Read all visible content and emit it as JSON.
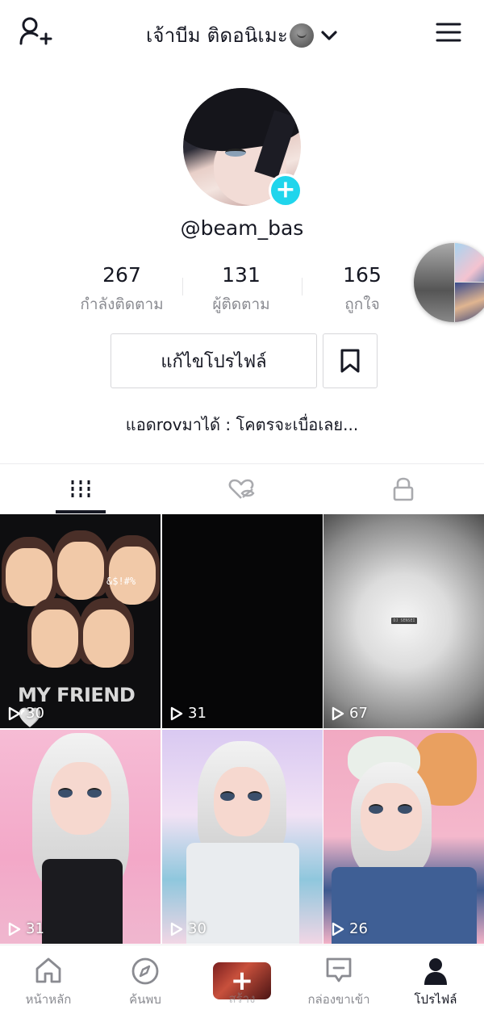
{
  "header": {
    "title": "เจ้าบีม ติดอนิเมะ",
    "add_friend_icon": "add-user-icon",
    "menu_icon": "hamburger-menu-icon"
  },
  "profile": {
    "username": "@beam_bas",
    "stats": [
      {
        "value": "267",
        "label": "กำลังติดตาม"
      },
      {
        "value": "131",
        "label": "ผู้ติดตาม"
      },
      {
        "value": "165",
        "label": "ถูกใจ"
      }
    ],
    "edit_label": "แก้ไขโปรไฟล์",
    "bio": "แอดrovมาได้ : โคตรจะเบื่อเลย..."
  },
  "tabs": [
    "videos-grid-icon",
    "liked-hidden-icon",
    "private-lock-icon"
  ],
  "videos": [
    {
      "plays": "30",
      "overlay_text": "MY FRIEND 🤍",
      "emoji_text": "&$!#%"
    },
    {
      "plays": "31"
    },
    {
      "plays": "67",
      "tiny_text": "DJ SENSEI"
    },
    {
      "plays": "31"
    },
    {
      "plays": "30"
    },
    {
      "plays": "26"
    }
  ],
  "nav": {
    "home": "หน้าหลัก",
    "discover": "ค้นพบ",
    "create": "สร้าง",
    "inbox": "กล่องขาเข้า",
    "profile": "โปรไฟล์"
  },
  "colors": {
    "accent": "#20d5ec",
    "text_primary": "#161823",
    "text_secondary": "#8a8b91"
  }
}
